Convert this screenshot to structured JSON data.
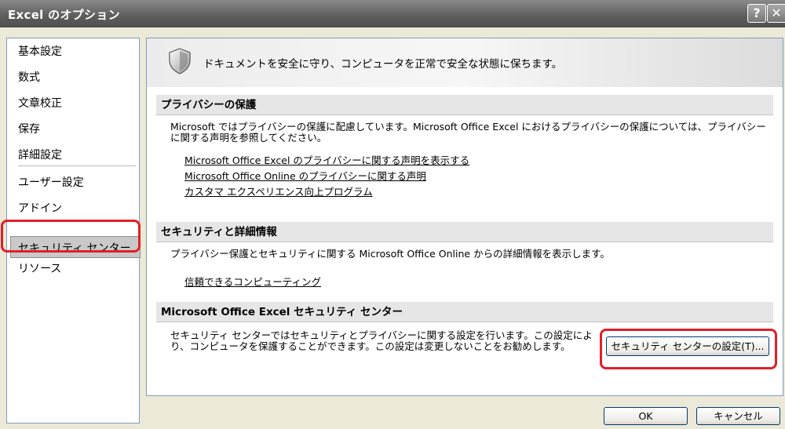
{
  "window": {
    "title": "Excel のオプション",
    "help_label": "?",
    "close_label": "✕"
  },
  "sidebar": {
    "items": [
      {
        "label": "基本設定"
      },
      {
        "label": "数式"
      },
      {
        "label": "文章校正"
      },
      {
        "label": "保存"
      },
      {
        "label": "詳細設定"
      },
      {
        "label": "ユーザー設定"
      },
      {
        "label": "アドイン"
      },
      {
        "label": "セキュリティ センター"
      },
      {
        "label": "リソース"
      }
    ],
    "selected": "セキュリティ センター"
  },
  "banner": {
    "icon": "shield-icon",
    "text": "ドキュメントを安全に守り、コンピュータを正常で安全な状態に保ちます。"
  },
  "privacy": {
    "heading": "プライバシーの保護",
    "text": "Microsoft ではプライバシーの保護に配慮しています。Microsoft Office Excel におけるプライバシーの保護については、プライバシーに関する声明を参照してください。",
    "links": [
      {
        "label": "Microsoft Office Excel のプライバシーに関する声明を表示する"
      },
      {
        "label": "Microsoft Office Online のプライバシーに関する声明"
      },
      {
        "label": "カスタマ エクスペリエンス向上プログラム"
      }
    ]
  },
  "security_info": {
    "heading": "セキュリティと詳細情報",
    "text": "プライバシー保護とセキュリティに関する Microsoft Office Online からの詳細情報を表示します。",
    "links": [
      {
        "label": "信頼できるコンピューティング"
      }
    ]
  },
  "trust_center": {
    "heading": "Microsoft Office Excel セキュリティ センター",
    "text": "セキュリティ センターではセキュリティとプライバシーに関する設定を行います。この設定により、コンピュータを保護することができます。この設定は変更しないことをお勧めします。",
    "button_label": "セキュリティ センターの設定(T)..."
  },
  "footer": {
    "ok_label": "OK",
    "cancel_label": "キャンセル"
  },
  "colors": {
    "highlight": "#e0202a",
    "titlebar": "#5f5f5f"
  }
}
